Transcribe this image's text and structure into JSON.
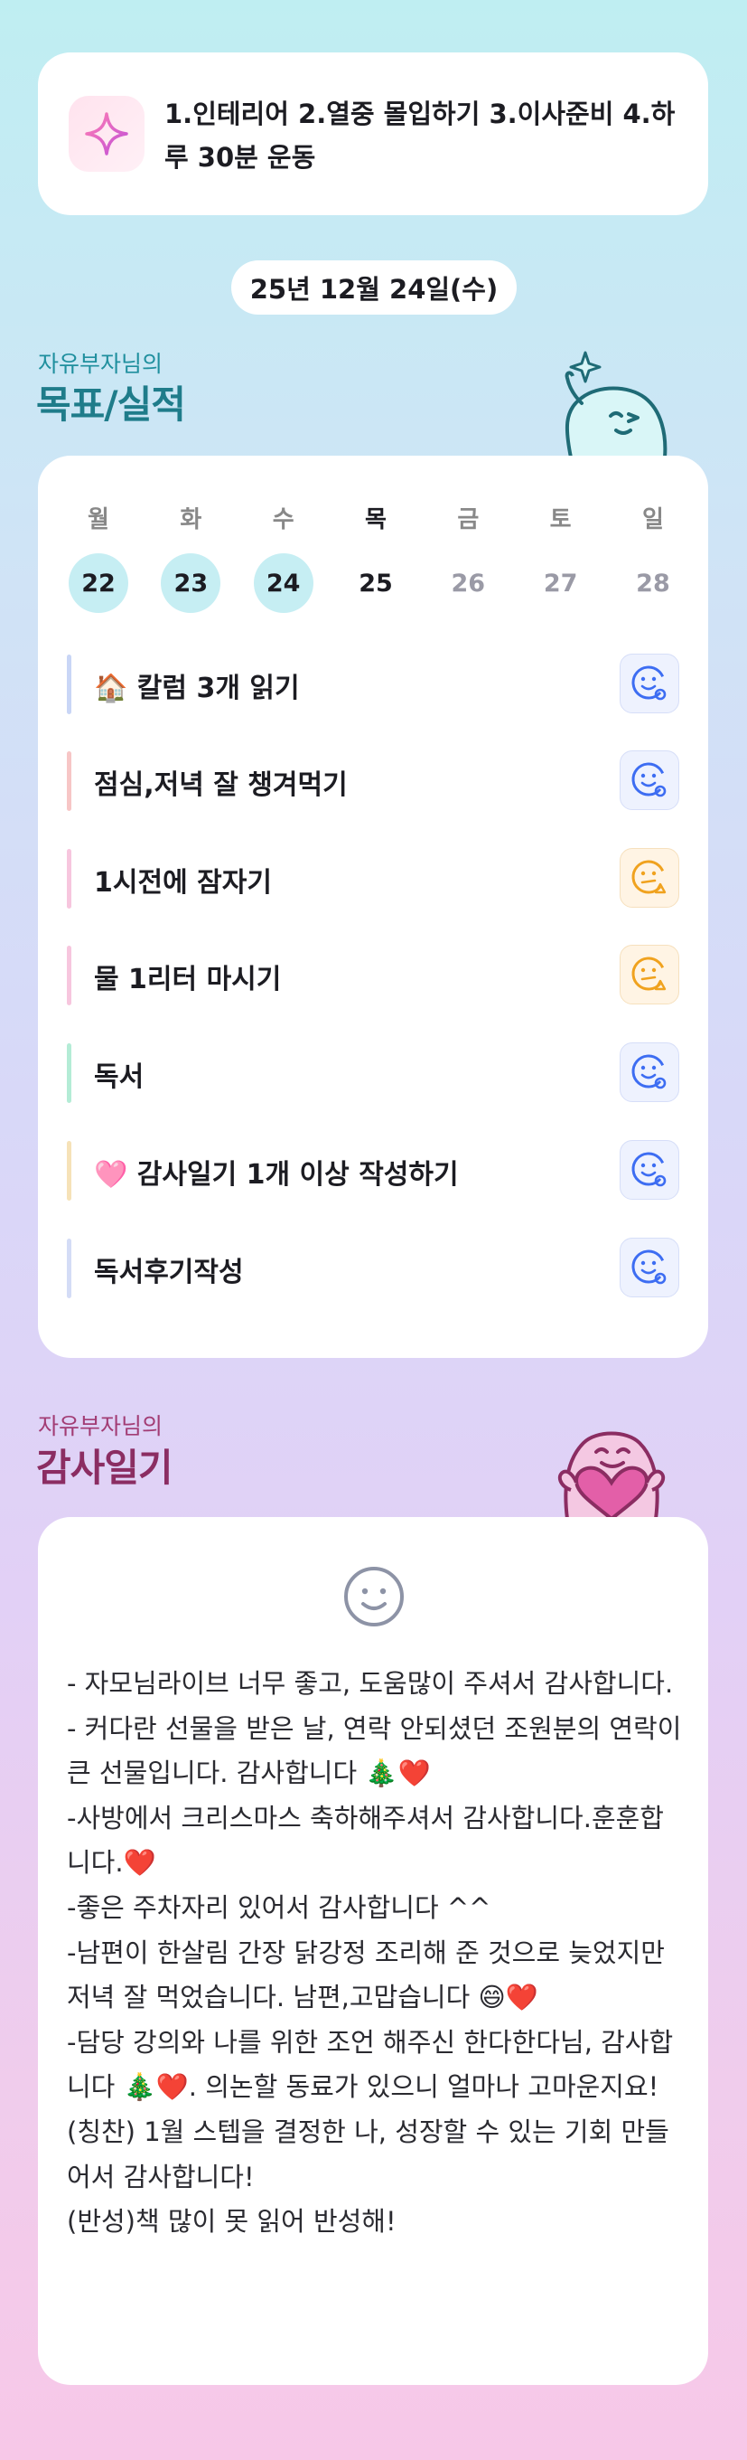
{
  "goal_banner": {
    "icon": "sparkle-icon",
    "text": "1.인테리어 2.열중 몰입하기 3.이사준비 4.하루 30분 운동"
  },
  "date_label": "25년 12월 24일(수)",
  "goals_section": {
    "subtitle": "자유부자님의",
    "title": "목표/실적",
    "weekdays": [
      "월",
      "화",
      "수",
      "목",
      "금",
      "토",
      "일"
    ],
    "dates": [
      {
        "label": "22",
        "state": "done"
      },
      {
        "label": "23",
        "state": "done"
      },
      {
        "label": "24",
        "state": "done"
      },
      {
        "label": "25",
        "state": "today"
      },
      {
        "label": "26",
        "state": "future"
      },
      {
        "label": "27",
        "state": "future"
      },
      {
        "label": "28",
        "state": "future"
      }
    ],
    "tasks": [
      {
        "label": "🏠 칼럼 3개 읽기",
        "bar_color": "#c9d6f6",
        "status": "good-face-icon"
      },
      {
        "label": "점심,저녁 잘 챙겨먹기",
        "bar_color": "#f7c6c6",
        "status": "good-face-icon"
      },
      {
        "label": "1시전에 잠자기",
        "bar_color": "#f7c6de",
        "status": "meh-face-icon"
      },
      {
        "label": "물 1리터 마시기",
        "bar_color": "#f7c6de",
        "status": "meh-face-icon"
      },
      {
        "label": "독서",
        "bar_color": "#b4ecd6",
        "status": "good-face-icon"
      },
      {
        "label": "🩷 감사일기 1개 이상 작성하기",
        "bar_color": "#f6e2b8",
        "status": "good-face-icon"
      },
      {
        "label": "독서후기작성",
        "bar_color": "#d4dcf6",
        "status": "good-face-icon"
      }
    ]
  },
  "diary_section": {
    "subtitle": "자유부자님의",
    "title": "감사일기",
    "mood_icon": "smile-face-icon",
    "text": "- 자모님라이브 너무 좋고, 도움많이 주셔서 감사합니다.\n- 커다란 선물을 받은 날, 연락 안되셨던 조원분의 연락이 큰 선물입니다. 감사합니다 🎄❤️\n-사방에서 크리스마스 축하해주셔서 감사합니다.훈훈합니다.❤️\n-좋은 주차자리 있어서 감사합니다 ^^\n-남편이 한살림 간장 닭강정 조리해 준 것으로 늦었지만 저녁 잘 먹었습니다. 남편,고맙습니다 😄❤️\n-담당 강의와 나를 위한 조언 해주신 한다한다님, 감사합니다 🎄❤️. 의논할 동료가 있으니 얼마나 고마운지요!\n(칭찬) 1월 스텝을 결정한 나, 성장할 수 있는 기회 만들어서 감사합니다!\n(반성)책 많이 못 읽어 반성해!"
  },
  "colors": {
    "accent_teal": "#1f7c8a",
    "accent_pink": "#8b2d62",
    "good_icon": "#3d6df2",
    "meh_icon": "#f0a21e"
  }
}
